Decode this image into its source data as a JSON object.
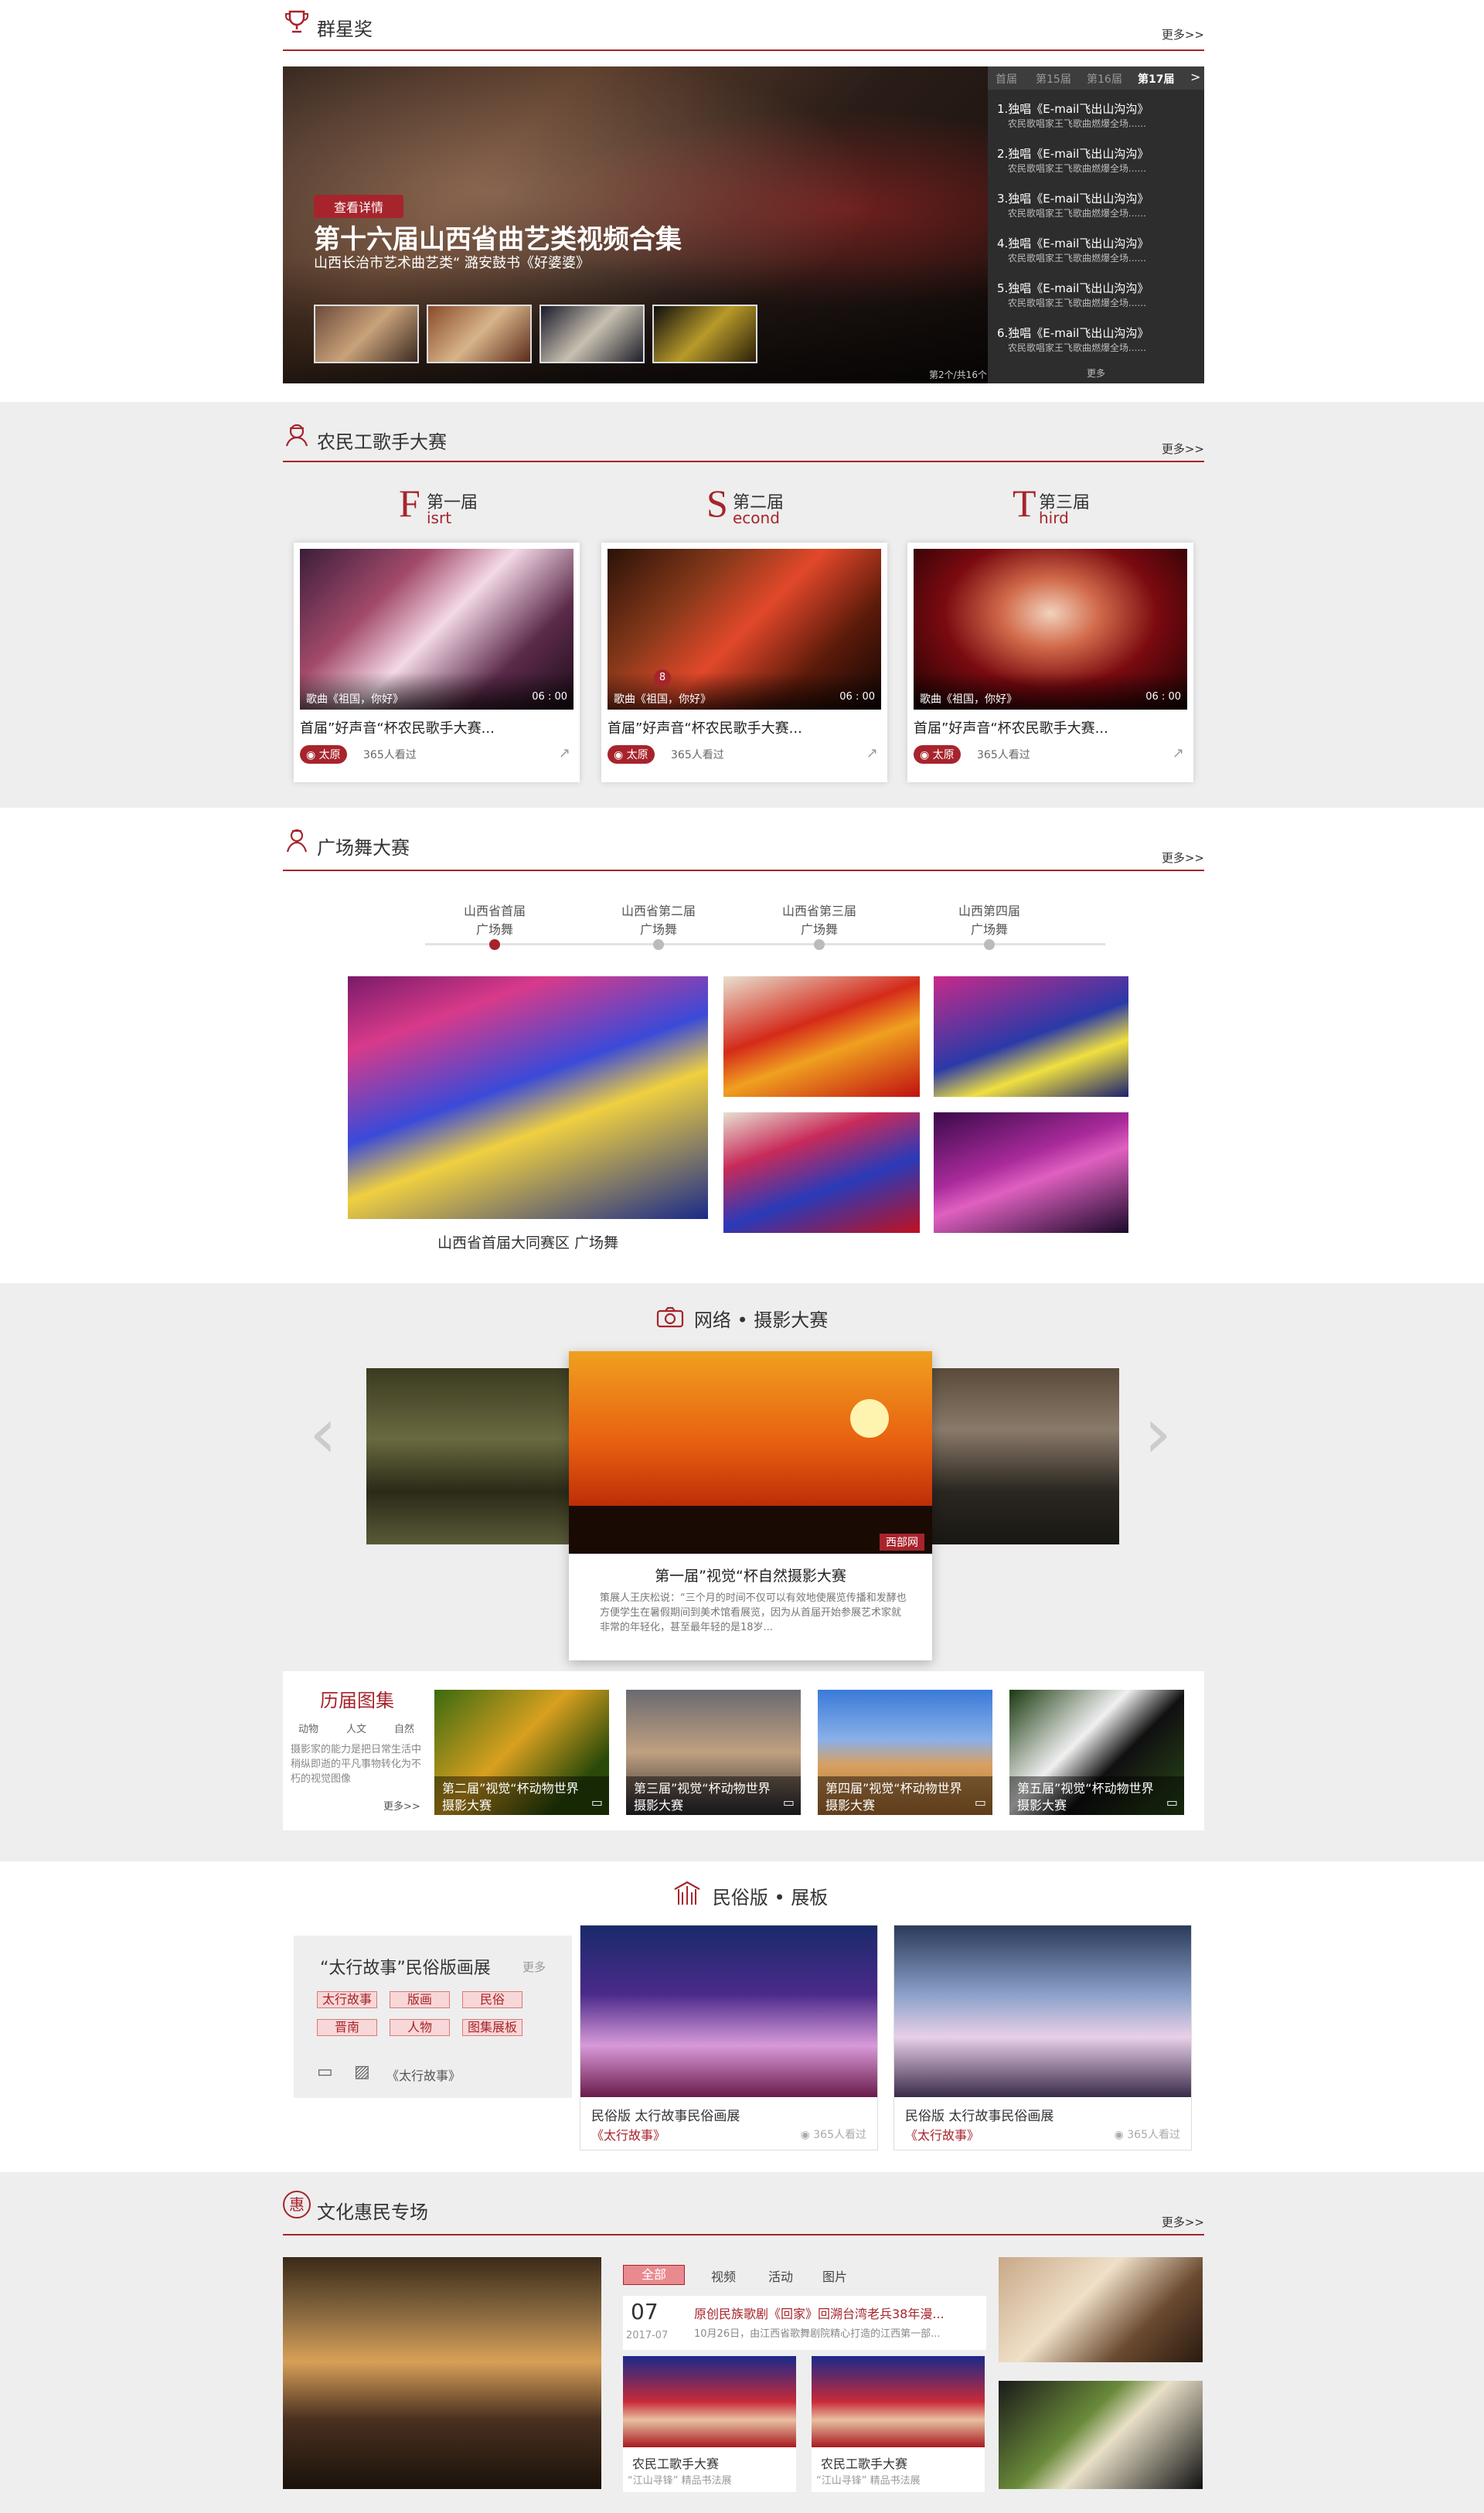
{
  "s1": {
    "title": "群星奖",
    "more": "更多>>",
    "banner": {
      "badge": "查看详情",
      "headline": "第十六届山西省曲艺类视频合集",
      "sub": "山西长治市艺术曲艺类“ 潞安鼓书《好婆婆》",
      "counter": "第2个/共16个"
    },
    "tabs": [
      "首届",
      "第15届",
      "第16届",
      "第17届"
    ],
    "tab_arrow": ">",
    "list": [
      {
        "t": "1.独唱《E-mail飞出山沟沟》",
        "s": "农民歌唱家王飞歌曲燃爆全场......"
      },
      {
        "t": "2.独唱《E-mail飞出山沟沟》",
        "s": "农民歌唱家王飞歌曲燃爆全场......"
      },
      {
        "t": "3.独唱《E-mail飞出山沟沟》",
        "s": "农民歌唱家王飞歌曲燃爆全场......"
      },
      {
        "t": "4.独唱《E-mail飞出山沟沟》",
        "s": "农民歌唱家王飞歌曲燃爆全场......"
      },
      {
        "t": "5.独唱《E-mail飞出山沟沟》",
        "s": "农民歌唱家王飞歌曲燃爆全场......"
      },
      {
        "t": "6.独唱《E-mail飞出山沟沟》",
        "s": "农民歌唱家王飞歌曲燃爆全场......"
      }
    ],
    "list_more": "更多"
  },
  "s2": {
    "title": "农民工歌手大赛",
    "more": "更多>>",
    "editions": [
      {
        "big": "F",
        "cn": "第一届",
        "en": "isrt",
        "cap": "歌曲《祖国，你好》",
        "dur": "06 : 00",
        "title": "首届”好声音“杯农民歌手大赛...",
        "loc": "太原",
        "views": "365人看过",
        "badge": ""
      },
      {
        "big": "S",
        "cn": "第二届",
        "en": "econd",
        "cap": "歌曲《祖国，你好》",
        "dur": "06 : 00",
        "title": "首届”好声音“杯农民歌手大赛...",
        "loc": "太原",
        "views": "365人看过",
        "badge": "8"
      },
      {
        "big": "T",
        "cn": "第三届",
        "en": "hird",
        "cap": "歌曲《祖国，你好》",
        "dur": "06 : 00",
        "title": "首届”好声音“杯农民歌手大赛...",
        "loc": "太原",
        "views": "365人看过",
        "badge": ""
      }
    ]
  },
  "s3": {
    "title": "广场舞大赛",
    "more": "更多>>",
    "timeline": [
      {
        "a": "山西省首届",
        "b": "广场舞"
      },
      {
        "a": "山西省第二届",
        "b": "广场舞"
      },
      {
        "a": "山西省第三届",
        "b": "广场舞"
      },
      {
        "a": "山西第四届",
        "b": "广场舞"
      }
    ],
    "main_caption": "山西省首届大同赛区 广场舞"
  },
  "s4": {
    "title": "网络 • 摄影大赛",
    "featured": {
      "source": "西部网",
      "title": "第一届”视觉“杯自然摄影大赛",
      "desc": "策展人王庆松说：“三个月的时间不仅可以有效地使展览传播和发酵也方便学生在暑假期间到美术馆看展览，因为从首届开始参展艺术家就非常的年轻化，甚至最年轻的是18岁..."
    },
    "prev": "‹",
    "next": "›",
    "album": {
      "title": "历届图集",
      "tags": [
        "动物",
        "人文",
        "自然"
      ],
      "desc": "摄影家的能力是把日常生活中稍纵即逝的平凡事物转化为不朽的视觉图像",
      "more": "更多>>"
    },
    "gallery": [
      {
        "t1": "第二届”视觉“杯动物世界",
        "t2": "摄影大赛"
      },
      {
        "t1": "第三届”视觉“杯动物世界",
        "t2": "摄影大赛"
      },
      {
        "t1": "第四届”视觉“杯动物世界",
        "t2": "摄影大赛"
      },
      {
        "t1": "第五届”视觉“杯动物世界",
        "t2": "摄影大赛"
      }
    ]
  },
  "s5": {
    "title": "民俗版 • 展板",
    "panel": {
      "title": "“太行故事”民俗版画展",
      "more": "更多",
      "chips": [
        "太行故事",
        "版画",
        "民俗",
        "晋南",
        "人物",
        "图集展板"
      ],
      "note": "《太行故事》"
    },
    "items": [
      {
        "t": "民俗版 太行故事民俗画展",
        "s": "《太行故事》",
        "v": "365人看过"
      },
      {
        "t": "民俗版 太行故事民俗画展",
        "s": "《太行故事》",
        "v": "365人看过"
      }
    ]
  },
  "s6": {
    "title": "文化惠民专场",
    "icon_char": "惠",
    "more": "更多>>",
    "tabs": [
      "全部",
      "视频",
      "活动",
      "图片"
    ],
    "news": {
      "day": "07",
      "ym": "2017-07",
      "title": "原创民族歌剧《回家》回溯台湾老兵38年漫...",
      "desc": "10月26日，由江西省歌舞剧院精心打造的江西第一部..."
    },
    "cards": [
      {
        "t": "农民工歌手大赛",
        "s": "“江山寻锋” 精品书法展"
      },
      {
        "t": "农民工歌手大赛",
        "s": "“江山寻锋” 精品书法展"
      }
    ]
  }
}
